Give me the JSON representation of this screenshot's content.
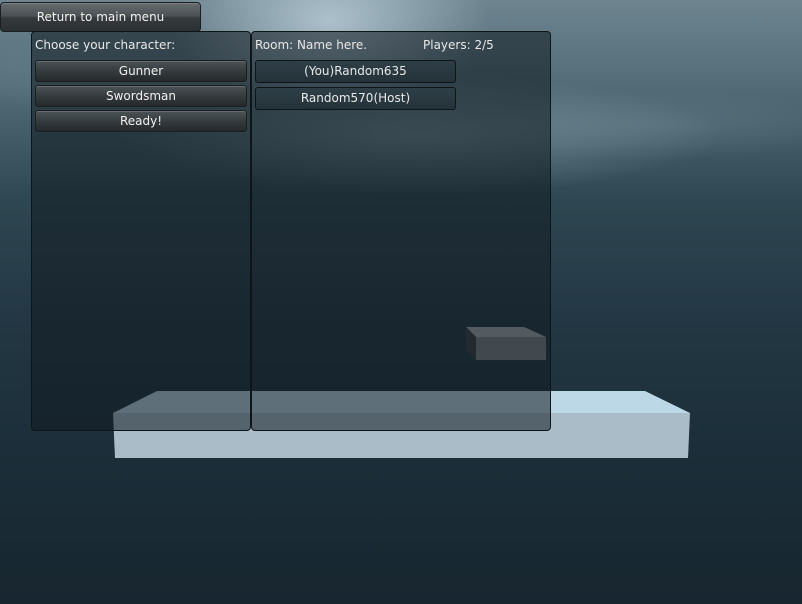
{
  "top_bar": {
    "return_label": "Return to main menu"
  },
  "character_panel": {
    "heading": "Choose your character:",
    "options": [
      {
        "label": "Gunner"
      },
      {
        "label": "Swordsman"
      },
      {
        "label": "Ready!"
      }
    ]
  },
  "room_panel": {
    "room_label": "Room: Name here.",
    "players_label": "Players: 2/5",
    "players": [
      {
        "name": "(You)Random635"
      },
      {
        "name": "Random570(Host)"
      }
    ]
  },
  "scene": {
    "background": "dark cloudy sky",
    "colors": {
      "sky_top": "#6e8590",
      "sky_bottom": "#17262f",
      "platform_top": "#bcd7e6",
      "platform_front": "#a9bcc8",
      "block_top": "#a4abb0",
      "block_front": "#7d8387",
      "block_side": "#3b3f42"
    }
  }
}
